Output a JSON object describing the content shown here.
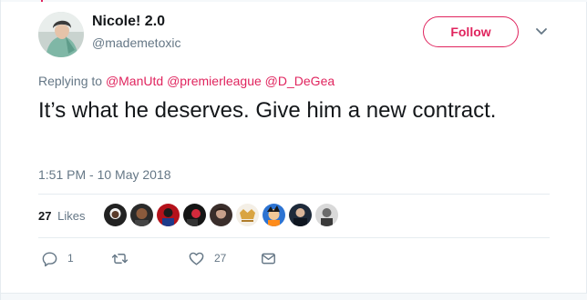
{
  "user": {
    "display_name": "Nicole! 2.0",
    "handle": "@mademetoxic",
    "avatar": "user-avatar"
  },
  "follow_label": "Follow",
  "accent_color": "#e0245e",
  "replying_to": {
    "prefix": "Replying to",
    "mentions": [
      "@ManUtd",
      "@premierleague",
      "@D_DeGea"
    ]
  },
  "tweet": {
    "text": "It’s what he deserves. Give him a new contract.",
    "timestamp": "1:51 PM - 10 May 2018"
  },
  "stats": {
    "likes_count": "27",
    "likes_label": "Likes",
    "liker_avatars": [
      "liker-avatar-1",
      "liker-avatar-2",
      "liker-avatar-3",
      "liker-avatar-4",
      "liker-avatar-5",
      "liker-avatar-6",
      "liker-avatar-7",
      "liker-avatar-8",
      "liker-avatar-9"
    ]
  },
  "actions": {
    "reply": {
      "icon": "reply-icon",
      "count": "1"
    },
    "retweet": {
      "icon": "retweet-icon",
      "count": ""
    },
    "like": {
      "icon": "heart-icon",
      "count": "27"
    },
    "message": {
      "icon": "envelope-icon",
      "count": ""
    }
  }
}
